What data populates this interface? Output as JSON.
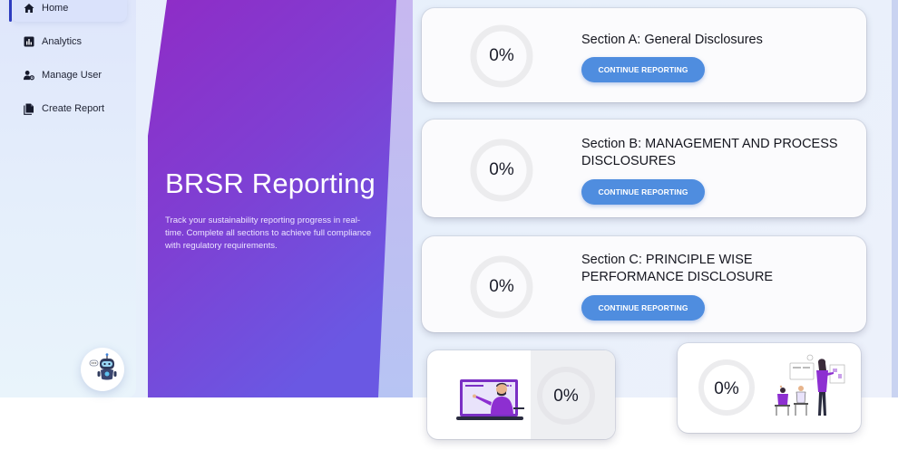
{
  "sidebar": {
    "items": [
      {
        "label": "Home",
        "icon": "home-icon",
        "active": true
      },
      {
        "label": "Analytics",
        "icon": "analytics-icon",
        "active": false
      },
      {
        "label": "Manage User",
        "icon": "manage-user-icon",
        "active": false
      },
      {
        "label": "Create Report",
        "icon": "create-report-icon",
        "active": false
      }
    ]
  },
  "hero": {
    "title": "BRSR Reporting",
    "description": "Track your sustainability reporting progress in real-time. Complete all sections to achieve full compliance with regulatory requirements."
  },
  "sections": [
    {
      "title": "Section A: General Disclosures",
      "progress": "0%",
      "button": "CONTINUE REPORTING"
    },
    {
      "title": "Section B: MANAGEMENT AND PROCESS DISCLOSURES",
      "progress": "0%",
      "button": "CONTINUE REPORTING"
    },
    {
      "title": "Section C: PRINCIPLE WISE PERFORMANCE DISCLOSURE",
      "progress": "0%",
      "button": "CONTINUE REPORTING"
    }
  ],
  "mini_cards": [
    {
      "progress": "0%",
      "illustration": "presenter-laptop-illustration"
    },
    {
      "progress": "0%",
      "illustration": "team-meeting-illustration"
    }
  ],
  "colors": {
    "accent_button": "#4f8ddf",
    "hero_purple_top": "#8b2fc9",
    "hero_purple_bottom": "#6a55e0",
    "ring_track": "#ececee"
  }
}
